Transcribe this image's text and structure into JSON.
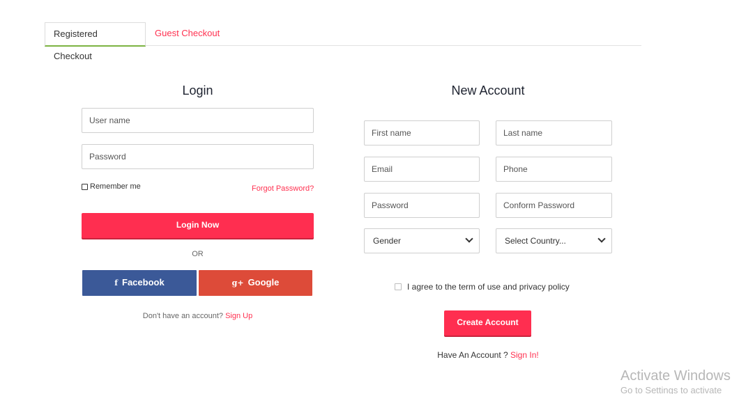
{
  "tabs": [
    {
      "label": "Registered Checkout",
      "active": true
    },
    {
      "label": "Guest Checkout",
      "active": false
    }
  ],
  "login": {
    "title": "Login",
    "username_placeholder": "User name",
    "password_placeholder": "Password",
    "remember_label": "Remember me",
    "forgot_label": "Forgot Password?",
    "login_button": "Login Now",
    "or_label": "OR",
    "facebook_label": "Facebook",
    "google_label": "Google",
    "facebook_icon": "f",
    "google_icon": "g+",
    "no_account_text": "Don't have an account?",
    "signup_link": "Sign Up"
  },
  "new_account": {
    "title": "New Account",
    "first_name_placeholder": "First name",
    "last_name_placeholder": "Last name",
    "email_placeholder": "Email",
    "phone_placeholder": "Phone",
    "password_placeholder": "Password",
    "confirm_password_placeholder": "Conform Password",
    "gender_selected": "Gender",
    "country_selected": "Select Country...",
    "agree_label": "I agree to the term of use and privacy policy",
    "create_button": "Create Account",
    "have_account_text": "Have An Account ?",
    "signin_link": "Sign In!"
  },
  "watermark": {
    "line1": "Activate Windows",
    "line2": "Go to Settings to activate"
  },
  "colors": {
    "accent": "#ff2e50",
    "facebook": "#3b5998",
    "google": "#dd4b39",
    "active_tab_underline": "#7cb342"
  }
}
